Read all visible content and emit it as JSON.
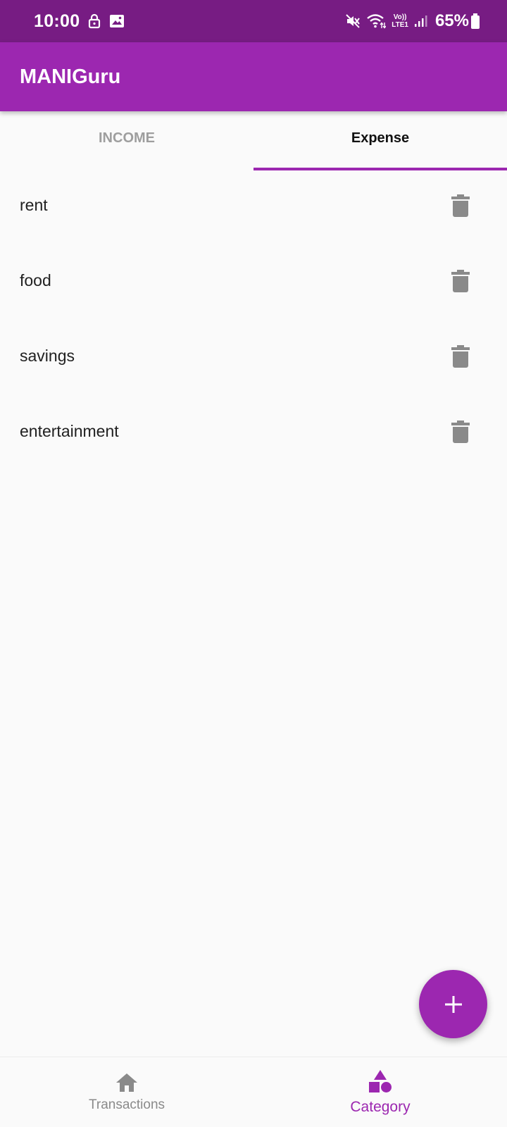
{
  "status_bar": {
    "time": "10:00",
    "battery": "65%",
    "network_label_top": "Vo))",
    "network_label_bottom": "LTE1",
    "icons": [
      "lock-icon",
      "image-icon",
      "mute-icon",
      "wifi-icon",
      "signal-icon",
      "battery-icon"
    ]
  },
  "app_bar": {
    "title": "MANIGuru"
  },
  "tabs": [
    {
      "label": "INCOME",
      "selected": false
    },
    {
      "label": "Expense",
      "selected": true
    }
  ],
  "categories": [
    {
      "label": "rent"
    },
    {
      "label": "food"
    },
    {
      "label": "savings"
    },
    {
      "label": "entertainment"
    }
  ],
  "fab": {
    "icon": "plus-icon"
  },
  "bottom_nav": [
    {
      "label": "Transactions",
      "icon": "home-icon",
      "selected": false
    },
    {
      "label": "Category",
      "icon": "category-shapes-icon",
      "selected": true
    }
  ],
  "colors": {
    "status_bar": "#771c83",
    "primary": "#9c27b0",
    "icon_gray": "#8a8a8a",
    "background": "#fafafa"
  }
}
